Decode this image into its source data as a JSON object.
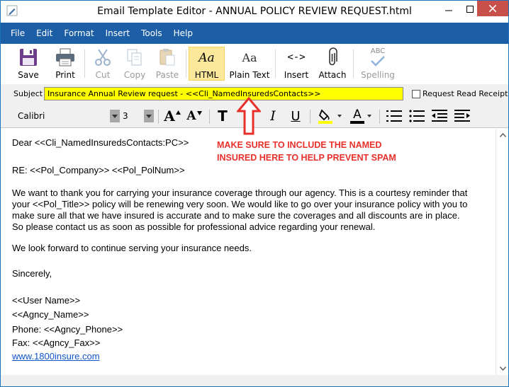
{
  "window": {
    "title": "Email Template Editor - ANNUAL POLICY REVIEW REQUEST.html"
  },
  "menu": [
    "File",
    "Edit",
    "Format",
    "Insert",
    "Tools",
    "Help"
  ],
  "toolbar": {
    "save": "Save",
    "print": "Print",
    "cut": "Cut",
    "copy": "Copy",
    "paste": "Paste",
    "html": "HTML",
    "html_glyph": "Aa",
    "plain": "Plain Text",
    "plain_glyph": "Aa",
    "insert": "Insert",
    "insert_glyph": "<->",
    "attach": "Attach",
    "spelling": "Spelling",
    "spelling_glyph": "ABC"
  },
  "subject": {
    "label": "Subject",
    "value": "Insurance Annual Review request - <<Cli_NamedInsuredsContacts>>",
    "read_receipt_label": "Request Read Receipt",
    "highlight_color": "#ffff00"
  },
  "format": {
    "font": "Calibri",
    "size": "3",
    "grow_glyph": "A",
    "shrink_glyph": "A",
    "clear_glyph": "T",
    "italic_glyph": "I",
    "underline_glyph": "U",
    "fontcolor_glyph": "A",
    "highlight_color": "#ffff00",
    "font_color": "#000000"
  },
  "body": {
    "greeting": "Dear <<Cli_NamedInsuredsContacts:PC>>",
    "re": "RE:  <<Pol_Company>> <<Pol_PolNum>>",
    "para1": [
      "We want to thank you for carrying your insurance coverage through our agency.  This is a courtesy reminder that",
      "your <<Pol_Title>> policy will be renewing very soon.  We would like to go over your insurance policy with you to",
      "make sure all that we have insured is accurate and to make sure the coverages and all discounts are in place.",
      "So please contact us as soon as possible for professional advice regarding your renewal."
    ],
    "para2": "We look forward to continue serving your insurance needs.",
    "closing": "Sincerely,",
    "signature": [
      "<<User Name>>",
      "<<Agncy_Name>>",
      "Phone: <<Agncy_Phone>>",
      "Fax: <<Agncy_Fax>>"
    ],
    "link": "www.1800insure.com"
  },
  "annotation": {
    "line1": "MAKE SURE TO INCLUDE THE NAMED",
    "line2": "INSURED HERE TO HELP PREVENT SPAM",
    "color": "#e8302b"
  },
  "colors": {
    "menubar": "#1d5fa7",
    "close": "#c7504b",
    "accent": "#fbe89a"
  }
}
